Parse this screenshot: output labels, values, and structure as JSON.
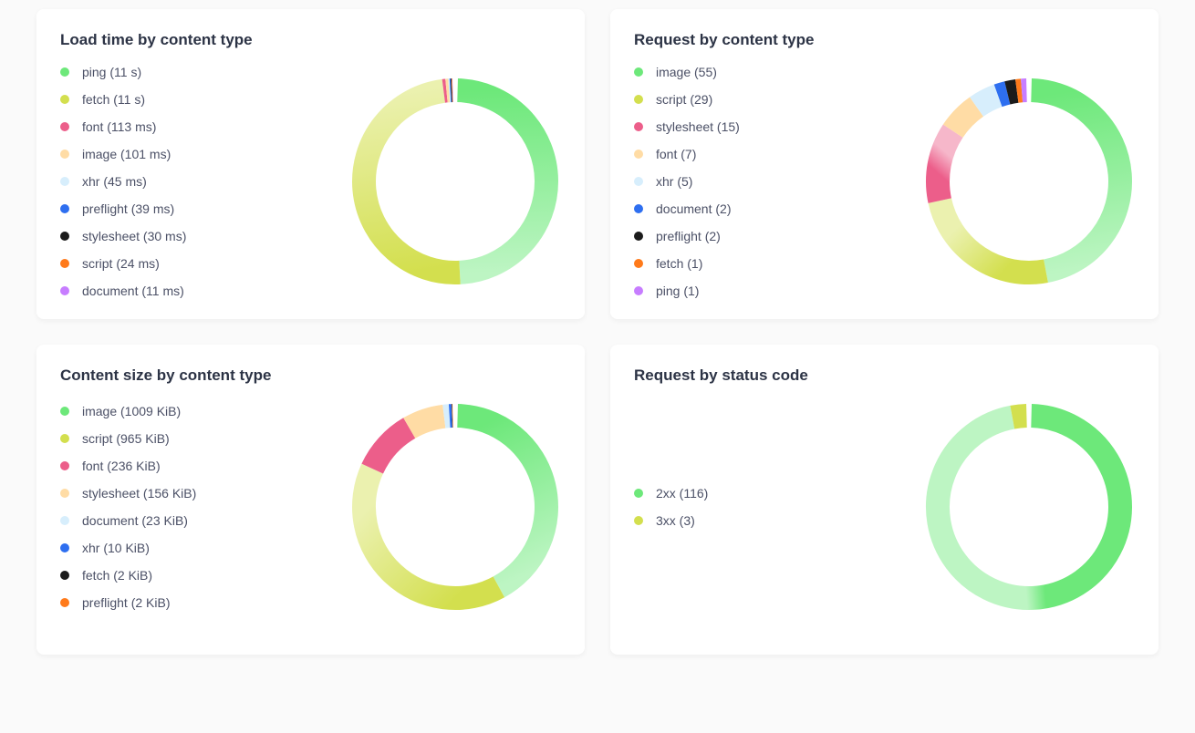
{
  "colors": {
    "green": "#6de87a",
    "olive": "#d3df4e",
    "pink": "#ec5e8a",
    "peach": "#ffdca5",
    "lightblue": "#d7eefc",
    "blue": "#2e6ff0",
    "black": "#1b1b1b",
    "orange": "#ff7a1a",
    "violet": "#c77dff",
    "grey": "#9aa0a6"
  },
  "cards": [
    {
      "id": "load-time",
      "title": "Load time by content type",
      "legend": [
        {
          "label": "ping (11 s)",
          "color": "green",
          "value": 11000
        },
        {
          "label": "fetch (11 s)",
          "color": "olive",
          "value": 11000
        },
        {
          "label": "font (113 ms)",
          "color": "pink",
          "value": 113
        },
        {
          "label": "image (101 ms)",
          "color": "peach",
          "value": 101
        },
        {
          "label": "xhr (45 ms)",
          "color": "lightblue",
          "value": 45
        },
        {
          "label": "preflight (39 ms)",
          "color": "blue",
          "value": 39
        },
        {
          "label": "stylesheet (30 ms)",
          "color": "black",
          "value": 30
        },
        {
          "label": "script (24 ms)",
          "color": "orange",
          "value": 24
        },
        {
          "label": "document (11 ms)",
          "color": "violet",
          "value": 11
        }
      ]
    },
    {
      "id": "request-type",
      "title": "Request by content type",
      "legend": [
        {
          "label": "image (55)",
          "color": "green",
          "value": 55
        },
        {
          "label": "script (29)",
          "color": "olive",
          "value": 29
        },
        {
          "label": "stylesheet (15)",
          "color": "pink",
          "value": 15
        },
        {
          "label": "font (7)",
          "color": "peach",
          "value": 7
        },
        {
          "label": "xhr (5)",
          "color": "lightblue",
          "value": 5
        },
        {
          "label": "document (2)",
          "color": "blue",
          "value": 2
        },
        {
          "label": "preflight (2)",
          "color": "black",
          "value": 2
        },
        {
          "label": "fetch (1)",
          "color": "orange",
          "value": 1
        },
        {
          "label": "ping (1)",
          "color": "violet",
          "value": 1
        }
      ]
    },
    {
      "id": "content-size",
      "title": "Content size by content type",
      "legend": [
        {
          "label": "image (1009 KiB)",
          "color": "green",
          "value": 1009
        },
        {
          "label": "script (965 KiB)",
          "color": "olive",
          "value": 965
        },
        {
          "label": "font (236 KiB)",
          "color": "pink",
          "value": 236
        },
        {
          "label": "stylesheet (156 KiB)",
          "color": "peach",
          "value": 156
        },
        {
          "label": "document (23 KiB)",
          "color": "lightblue",
          "value": 23
        },
        {
          "label": "xhr (10 KiB)",
          "color": "blue",
          "value": 10
        },
        {
          "label": "fetch (2 KiB)",
          "color": "black",
          "value": 2
        },
        {
          "label": "preflight (2 KiB)",
          "color": "orange",
          "value": 2
        }
      ]
    },
    {
      "id": "status-code",
      "title": "Request by status code",
      "legend_center": true,
      "legend": [
        {
          "label": "2xx (116)",
          "color": "green",
          "value": 116
        },
        {
          "label": "3xx (3)",
          "color": "olive",
          "value": 3
        }
      ]
    }
  ],
  "chart_data": [
    {
      "type": "pie",
      "title": "Load time by content type",
      "series": [
        {
          "name": "ping",
          "value": 11000,
          "unit": "ms"
        },
        {
          "name": "fetch",
          "value": 11000,
          "unit": "ms"
        },
        {
          "name": "font",
          "value": 113,
          "unit": "ms"
        },
        {
          "name": "image",
          "value": 101,
          "unit": "ms"
        },
        {
          "name": "xhr",
          "value": 45,
          "unit": "ms"
        },
        {
          "name": "preflight",
          "value": 39,
          "unit": "ms"
        },
        {
          "name": "stylesheet",
          "value": 30,
          "unit": "ms"
        },
        {
          "name": "script",
          "value": 24,
          "unit": "ms"
        },
        {
          "name": "document",
          "value": 11,
          "unit": "ms"
        }
      ]
    },
    {
      "type": "pie",
      "title": "Request by content type",
      "series": [
        {
          "name": "image",
          "value": 55
        },
        {
          "name": "script",
          "value": 29
        },
        {
          "name": "stylesheet",
          "value": 15
        },
        {
          "name": "font",
          "value": 7
        },
        {
          "name": "xhr",
          "value": 5
        },
        {
          "name": "document",
          "value": 2
        },
        {
          "name": "preflight",
          "value": 2
        },
        {
          "name": "fetch",
          "value": 1
        },
        {
          "name": "ping",
          "value": 1
        }
      ]
    },
    {
      "type": "pie",
      "title": "Content size by content type",
      "series": [
        {
          "name": "image",
          "value": 1009,
          "unit": "KiB"
        },
        {
          "name": "script",
          "value": 965,
          "unit": "KiB"
        },
        {
          "name": "font",
          "value": 236,
          "unit": "KiB"
        },
        {
          "name": "stylesheet",
          "value": 156,
          "unit": "KiB"
        },
        {
          "name": "document",
          "value": 23,
          "unit": "KiB"
        },
        {
          "name": "xhr",
          "value": 10,
          "unit": "KiB"
        },
        {
          "name": "fetch",
          "value": 2,
          "unit": "KiB"
        },
        {
          "name": "preflight",
          "value": 2,
          "unit": "KiB"
        }
      ]
    },
    {
      "type": "pie",
      "title": "Request by status code",
      "series": [
        {
          "name": "2xx",
          "value": 116
        },
        {
          "name": "3xx",
          "value": 3
        }
      ]
    }
  ]
}
